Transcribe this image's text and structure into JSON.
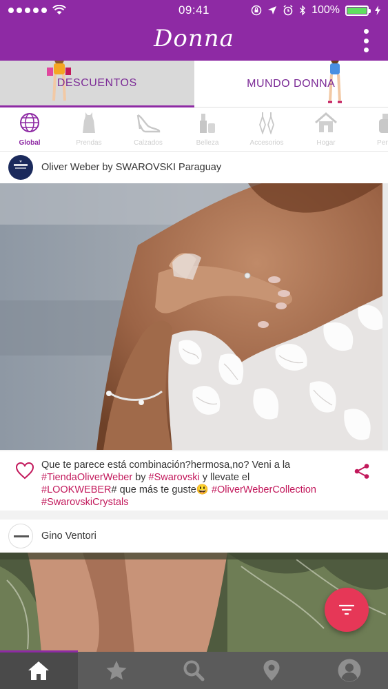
{
  "status_bar": {
    "time": "09:41",
    "battery": "100%",
    "battery_level": 1.0
  },
  "header": {
    "logo": "Donna",
    "menu_icon": "more-vertical-icon"
  },
  "top_tabs": [
    {
      "label": "DESCUENTOS",
      "active": true
    },
    {
      "label": "MUNDO DONNA",
      "active": false
    }
  ],
  "categories": [
    {
      "label": "Global",
      "icon": "globe-icon",
      "active": true
    },
    {
      "label": "Prendas",
      "icon": "dress-icon",
      "active": false
    },
    {
      "label": "Calzados",
      "icon": "heel-shoe-icon",
      "active": false
    },
    {
      "label": "Belleza",
      "icon": "cosmetics-icon",
      "active": false
    },
    {
      "label": "Accesorios",
      "icon": "earrings-icon",
      "active": false
    },
    {
      "label": "Hogar",
      "icon": "house-icon",
      "active": false
    },
    {
      "label": "Perfu",
      "icon": "perfume-icon",
      "active": false
    }
  ],
  "posts": [
    {
      "author": "Oliver Weber by SWAROVSKI Paraguay",
      "caption": {
        "line1_text": "Que te parece está combinación?hermosa,no? Veni a la",
        "tag1": "#TiendaOliverWeber",
        "by": " by ",
        "tag2": "#Swarovski",
        "mid": " y llevate el",
        "tag3": "#LOOKWEBER",
        "mid2": "# que más te guste",
        "emoji": "😃",
        "tag4": "#OliverWeberCollection",
        "tag5": "#SwarovskiCrystals"
      }
    },
    {
      "author": "Gino Ventori"
    }
  ],
  "fab": {
    "icon": "filter-icon"
  },
  "bottom_nav": [
    {
      "icon": "home-icon",
      "active": true
    },
    {
      "icon": "star-icon",
      "active": false
    },
    {
      "icon": "search-icon",
      "active": false
    },
    {
      "icon": "location-pin-icon",
      "active": false
    },
    {
      "icon": "profile-icon",
      "active": false
    }
  ],
  "colors": {
    "brand_purple": "#8e2aa4",
    "hashtag": "#c2185b",
    "fab": "#e63757",
    "nav_bg": "#5b5b5b"
  }
}
